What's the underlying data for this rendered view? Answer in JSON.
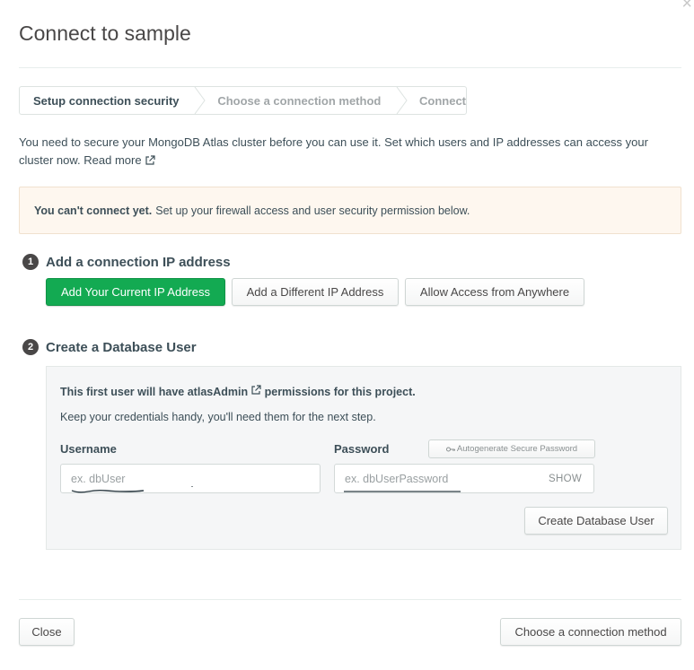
{
  "title": "Connect to sample",
  "steps": [
    {
      "label": "Setup connection security",
      "active": true
    },
    {
      "label": "Choose a connection method",
      "active": false
    },
    {
      "label": "Connect",
      "active": false
    }
  ],
  "intro": {
    "text": "You need to secure your MongoDB Atlas cluster before you can use it. Set which users and IP addresses can access your cluster now.",
    "link": "Read more"
  },
  "warning": {
    "bold": "You can't connect yet.",
    "text": "Set up your firewall access and user security permission below."
  },
  "section1": {
    "number": "1",
    "title": "Add a connection IP address",
    "buttons": {
      "current_ip": "Add Your Current IP Address",
      "different_ip": "Add a Different IP Address",
      "anywhere": "Allow Access from Anywhere"
    }
  },
  "section2": {
    "number": "2",
    "title": "Create a Database User",
    "first_user_prefix": "This first user will have",
    "first_user_role": "atlasAdmin",
    "first_user_suffix": "permissions for this project.",
    "subtitle": "Keep your credentials handy, you'll need them for the next step.",
    "username_label": "Username",
    "username_placeholder": "ex. dbUser",
    "password_label": "Password",
    "autogenerate": "Autogenerate Secure Password",
    "password_placeholder": "ex. dbUserPassword",
    "show": "SHOW",
    "create_button": "Create Database User"
  },
  "footer": {
    "close": "Close",
    "next": "Choose a connection method"
  },
  "colors": {
    "primary_green": "#13aa52",
    "warning_bg": "#fef7ef",
    "box_bg": "#f5f6f7"
  }
}
